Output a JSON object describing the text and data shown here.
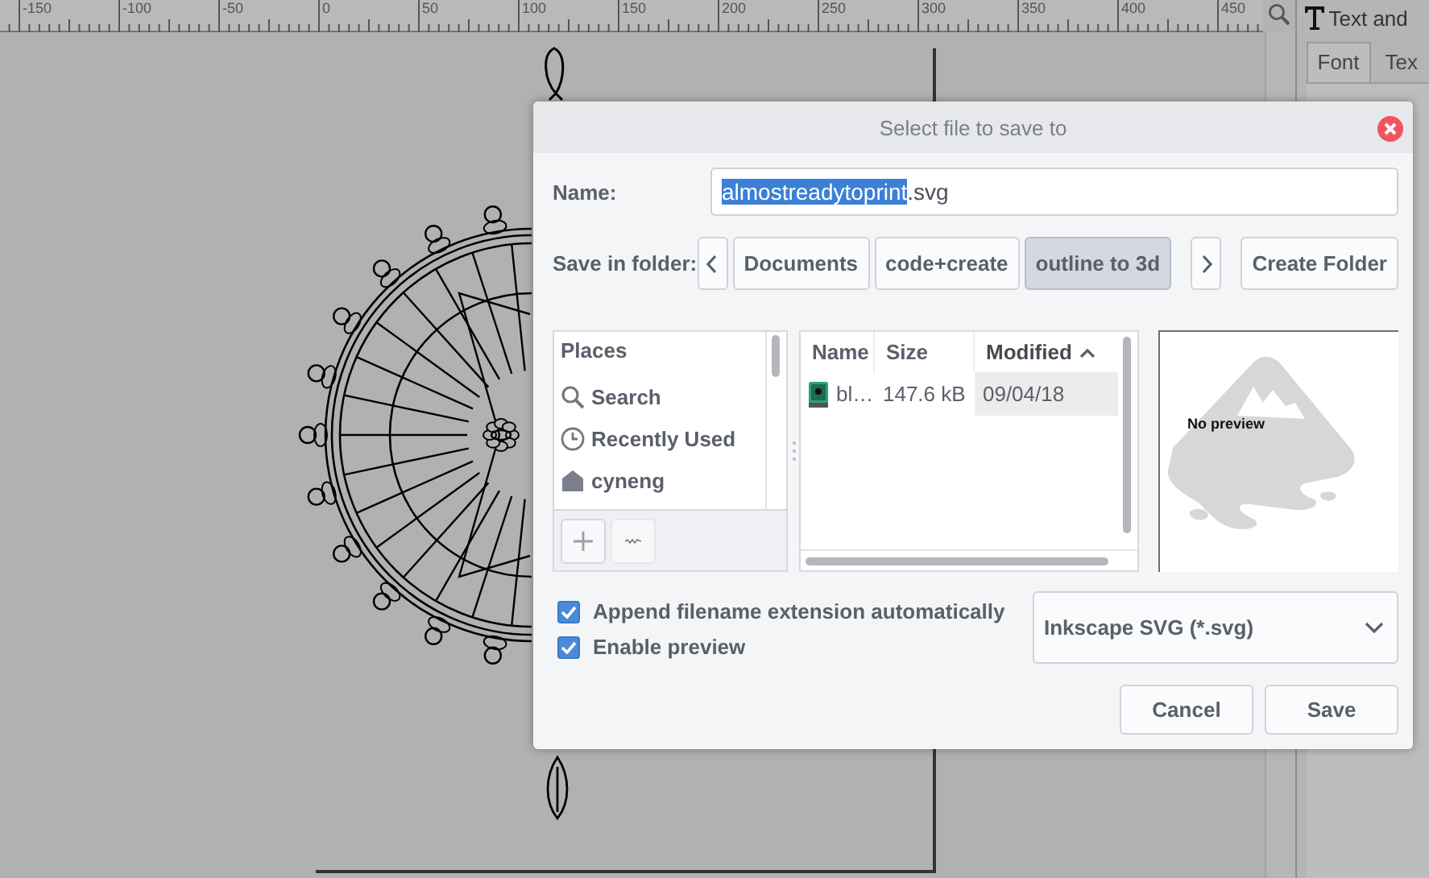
{
  "ruler": {
    "labels": [
      "-150",
      "-100",
      "-50",
      "0",
      "50",
      "100",
      "150",
      "200",
      "250",
      "300",
      "350",
      "400",
      "450"
    ]
  },
  "side_panel": {
    "title": "Text and",
    "tabs": [
      {
        "label": "Font",
        "selected": true
      },
      {
        "label": "Tex",
        "selected": false
      }
    ]
  },
  "dialog": {
    "title": "Select file to save to",
    "name_field": {
      "label": "Name:",
      "selected_text": "almostreadytoprint",
      "rest_text": ".svg"
    },
    "folder": {
      "label": "Save in folder:",
      "path": [
        {
          "label": "Documents",
          "selected": false
        },
        {
          "label": "code+create",
          "selected": false
        },
        {
          "label": "outline to 3d",
          "selected": true
        }
      ],
      "create_button": "Create Folder"
    },
    "places": {
      "heading": "Places",
      "items": [
        {
          "kind": "search",
          "label": "Search",
          "selected": false
        },
        {
          "kind": "recent",
          "label": "Recently Used",
          "selected": false
        },
        {
          "kind": "home",
          "label": "cyneng",
          "selected": false
        }
      ]
    },
    "files": {
      "columns": [
        {
          "label": "Name",
          "sorted": false
        },
        {
          "label": "Size",
          "sorted": false
        },
        {
          "label": "Modified",
          "sorted": true
        }
      ],
      "rows": [
        {
          "name": "bl…",
          "size": "147.6 kB",
          "modified": "09/04/18",
          "selected": false
        }
      ]
    },
    "preview": {
      "text": "No preview"
    },
    "options": [
      {
        "label": "Append filename extension automatically",
        "checked": true
      },
      {
        "label": "Enable preview",
        "checked": true
      }
    ],
    "file_type": "Inkscape SVG (*.svg)",
    "buttons": [
      "Cancel",
      "Save"
    ]
  }
}
